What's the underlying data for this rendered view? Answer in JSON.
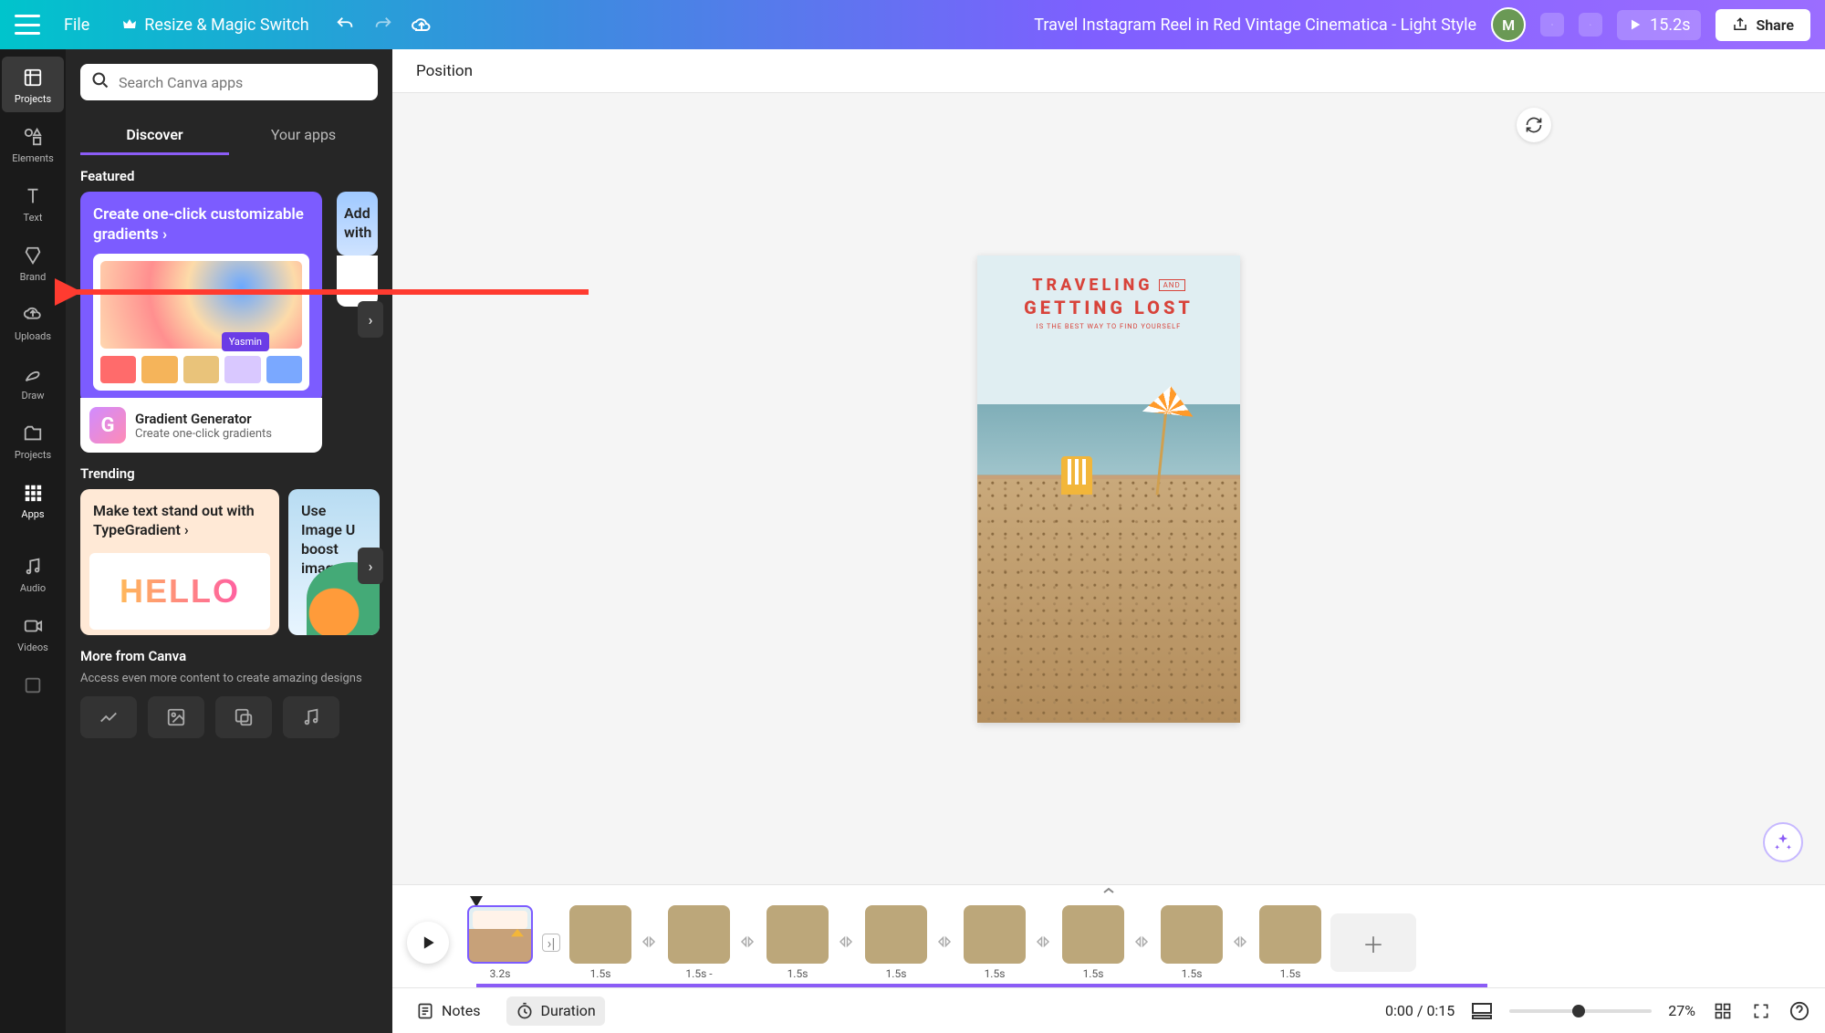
{
  "header": {
    "file": "File",
    "resize": "Resize & Magic Switch",
    "doc_title": "Travel Instagram Reel in Red Vintage Cinematica - Light Style",
    "avatar_letter": "M",
    "play_time": "15.2s",
    "share": "Share"
  },
  "rail": {
    "projects": "Projects",
    "elements": "Elements",
    "text": "Text",
    "brand": "Brand",
    "uploads": "Uploads",
    "draw": "Draw",
    "projects2": "Projects",
    "apps": "Apps",
    "audio": "Audio",
    "videos": "Videos"
  },
  "panel": {
    "search_placeholder": "Search Canva apps",
    "tab_discover": "Discover",
    "tab_your_apps": "Your apps",
    "featured": "Featured",
    "feat1_title": "Create one-click customizable gradients",
    "feat1_tag": "Yasmin",
    "feat1_app_title": "Gradient Generator",
    "feat1_app_desc": "Create one-click gradients",
    "feat2_title": "Add with",
    "trending": "Trending",
    "trend1_title": "Make text stand out with TypeGradient",
    "trend1_art": "HELLO",
    "trend2_title": "Use Image U boost image",
    "more_title": "More from Canva",
    "more_sub": "Access even more content to create amazing designs"
  },
  "position_bar": {
    "position": "Position"
  },
  "canvas_text": {
    "t1": "TRAVELING",
    "and": "AND",
    "t2": "GETTING LOST",
    "t3": "IS THE BEST WAY TO FIND YOURSELF"
  },
  "timeline": {
    "clips": [
      {
        "dur": "3.2s"
      },
      {
        "dur": "1.5s"
      },
      {
        "dur": "1.5s -"
      },
      {
        "dur": "1.5s"
      },
      {
        "dur": "1.5s"
      },
      {
        "dur": "1.5s"
      },
      {
        "dur": "1.5s"
      },
      {
        "dur": "1.5s"
      },
      {
        "dur": "1.5s"
      }
    ]
  },
  "bottom": {
    "notes": "Notes",
    "duration": "Duration",
    "time": "0:00 / 0:15",
    "zoom": "27%"
  }
}
